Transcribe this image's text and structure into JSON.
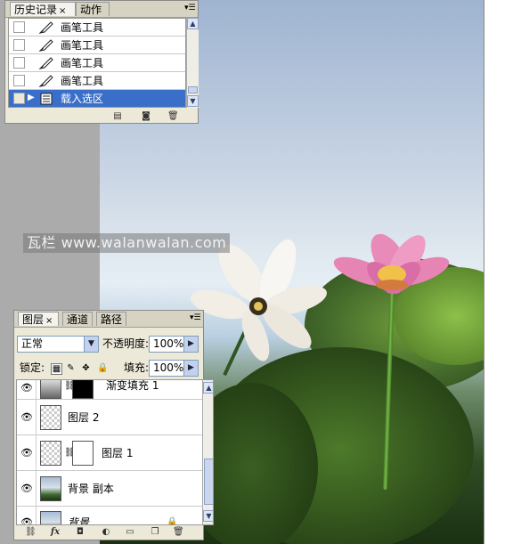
{
  "watermark": "瓦栏 www.walanwalan.com",
  "history_panel": {
    "tabs": [
      {
        "label": "历史记录",
        "close": "×"
      },
      {
        "label": "动作"
      }
    ],
    "menu_icon": "panel-menu-icon",
    "items": [
      {
        "label": "画笔工具",
        "icon": "brush-icon"
      },
      {
        "label": "画笔工具",
        "icon": "brush-icon"
      },
      {
        "label": "画笔工具",
        "icon": "brush-icon"
      },
      {
        "label": "画笔工具",
        "icon": "brush-icon"
      },
      {
        "label": "载入选区",
        "icon": "load-selection-icon",
        "selected": true
      }
    ],
    "footer_icons": [
      "new-document-from-state-icon",
      "new-snapshot-icon",
      "trash-icon"
    ]
  },
  "layers_panel": {
    "tabs": [
      {
        "label": "图层",
        "close": "×"
      },
      {
        "label": "通道"
      },
      {
        "label": "路径"
      }
    ],
    "blend_mode": "正常",
    "opacity_label": "不透明度:",
    "opacity_value": "100%",
    "lock_label": "锁定:",
    "fill_label": "填充:",
    "fill_value": "100%",
    "layers": [
      {
        "name": "渐变填充 1",
        "visible": true,
        "has_mask": true
      },
      {
        "name": "图层 2",
        "visible": true
      },
      {
        "name": "图层 1",
        "visible": true,
        "has_mask": true
      },
      {
        "name": "背景 副本",
        "visible": true
      },
      {
        "name": "背景",
        "visible": true,
        "locked": true
      }
    ],
    "footer_icons": [
      "link-icon",
      "fx-icon",
      "add-mask-icon",
      "adjustment-layer-icon",
      "new-group-icon",
      "new-layer-icon",
      "trash-icon"
    ],
    "fx_label": "fx"
  },
  "colors": {
    "selection": "#3a6fc9",
    "panel_bg": "#ece9d8",
    "workspace_gray": "#ababab"
  }
}
